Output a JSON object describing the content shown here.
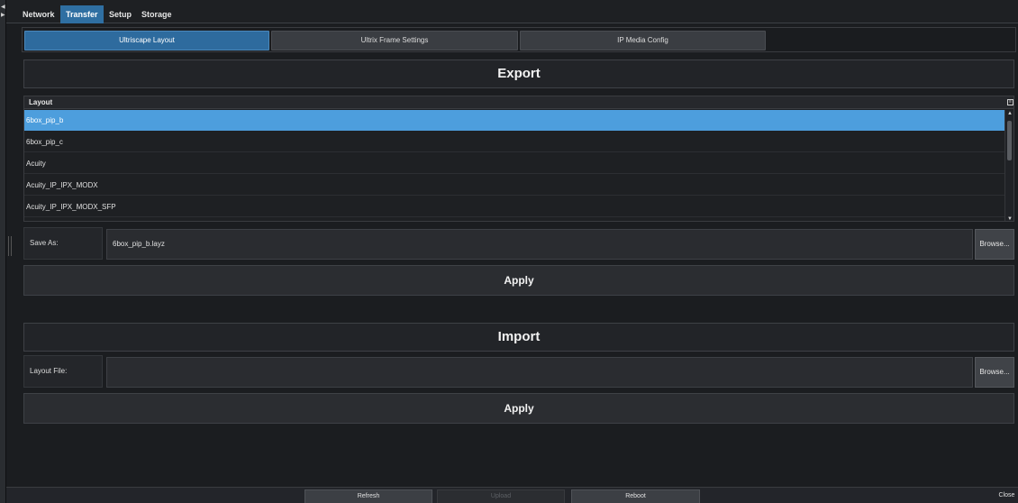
{
  "nav": {
    "tabs": [
      {
        "label": "Network"
      },
      {
        "label": "Transfer",
        "active": true
      },
      {
        "label": "Setup"
      },
      {
        "label": "Storage"
      }
    ]
  },
  "subtabs": [
    {
      "label": "Ultriscape Layout",
      "active": true
    },
    {
      "label": "Ultrix Frame Settings"
    },
    {
      "label": "IP Media Config"
    }
  ],
  "export": {
    "title": "Export",
    "table": {
      "header": "Layout",
      "rows": [
        "6box_pip_b",
        "6box_pip_c",
        "Acuity",
        "Acuity_IP_IPX_MODX",
        "Acuity_IP_IPX_MODX_SFP"
      ],
      "selected_index": 0
    },
    "save_as_label": "Save As:",
    "save_as_value": "6box_pip_b.layz",
    "browse_label": "Browse...",
    "apply_label": "Apply"
  },
  "import": {
    "title": "Import",
    "file_label": "Layout File:",
    "file_value": "",
    "browse_label": "Browse...",
    "apply_label": "Apply"
  },
  "footer": {
    "refresh_label": "Refresh",
    "upload_label": "Upload",
    "reboot_label": "Reboot",
    "close_label": "Close"
  },
  "colors": {
    "accent": "#2e6b9e",
    "selected_row": "#4d9edd",
    "background": "#1b1d20"
  }
}
